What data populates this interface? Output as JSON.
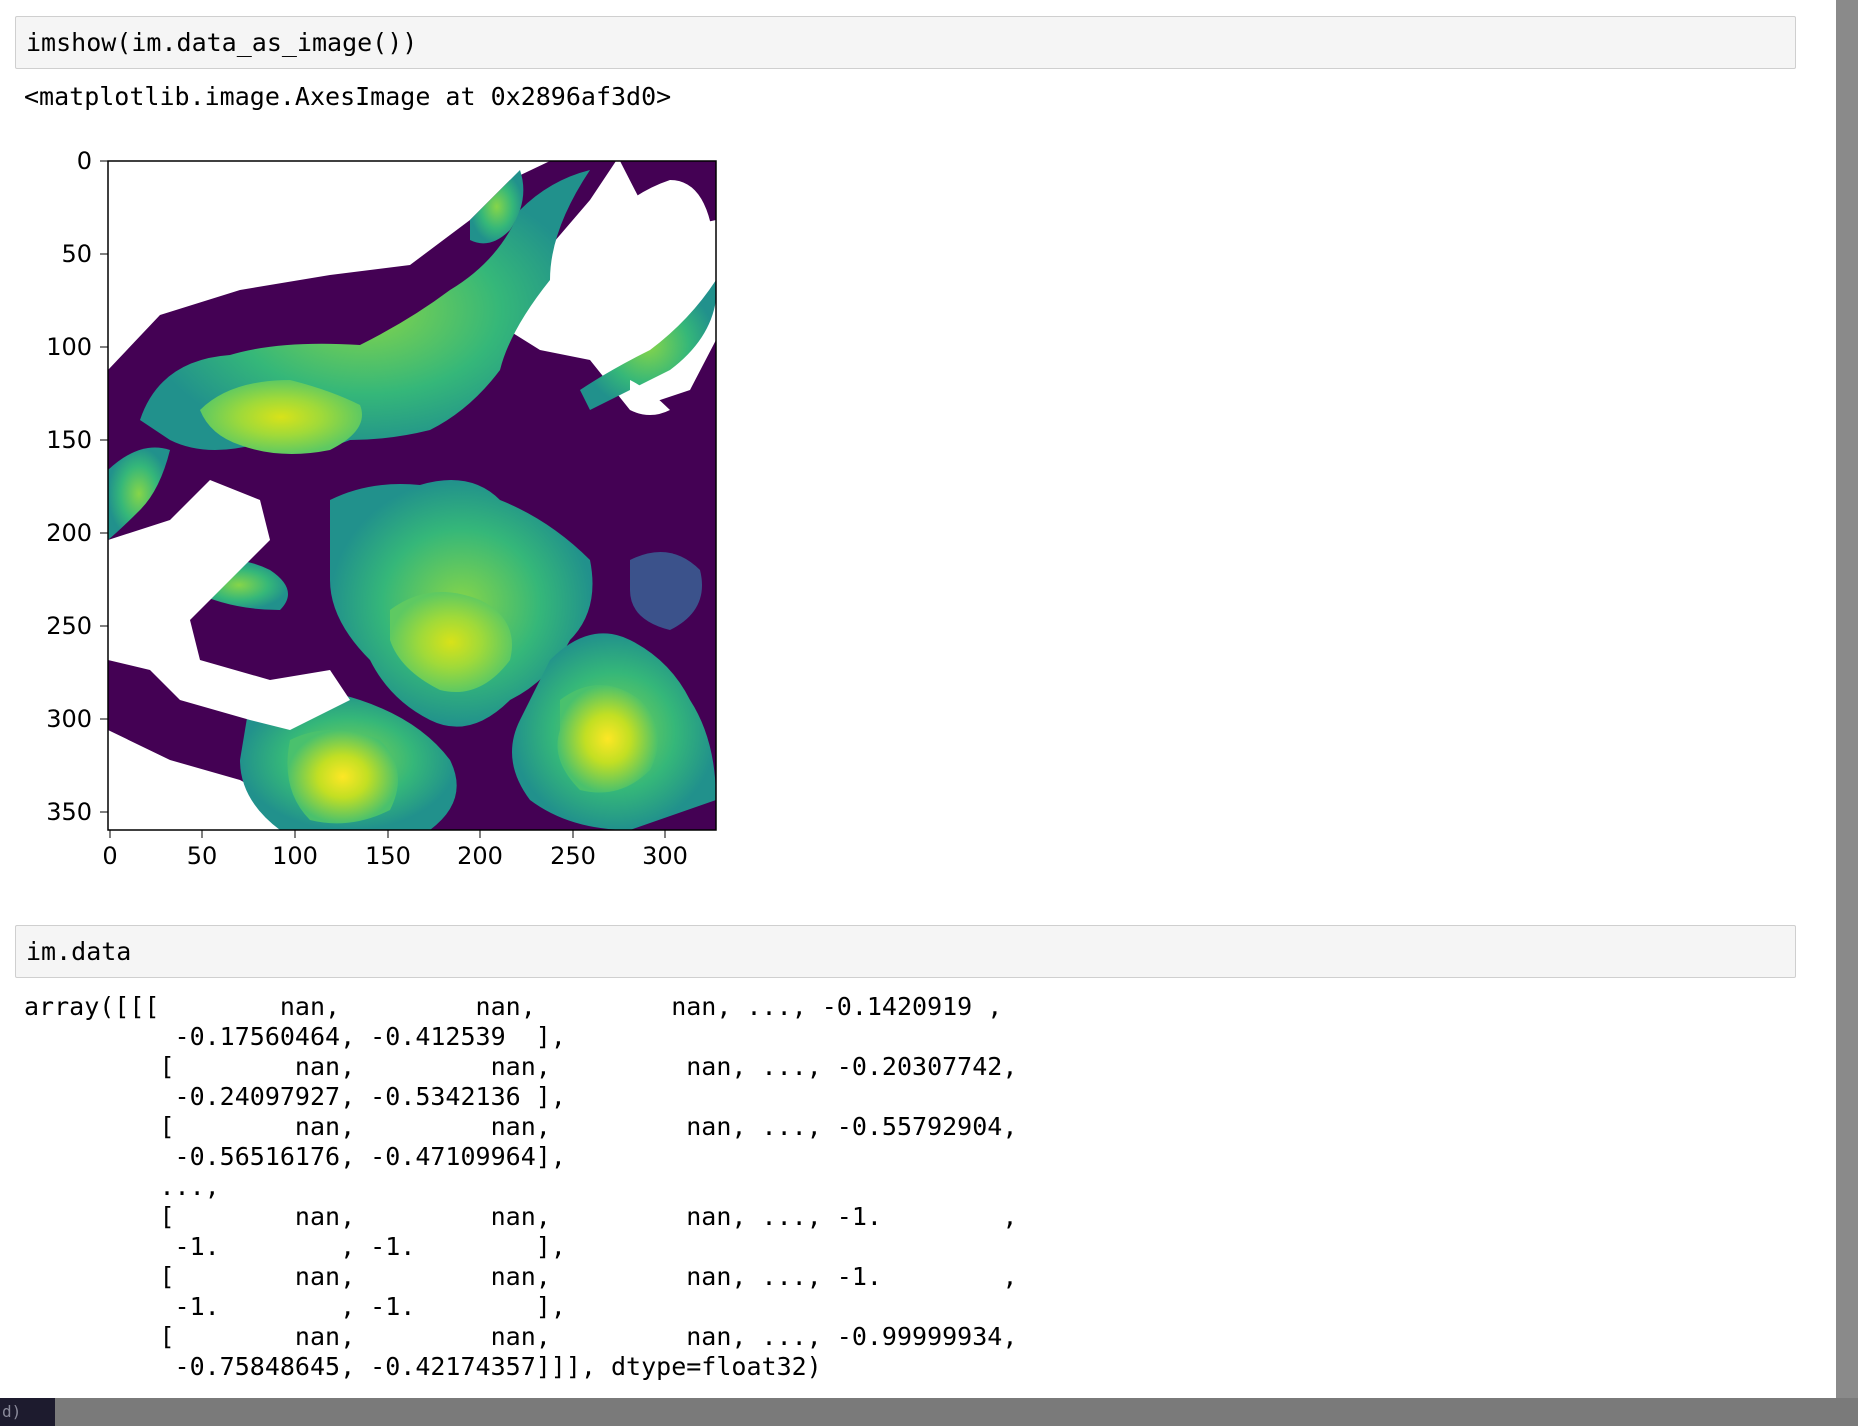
{
  "cells": [
    {
      "input": "imshow(im.data_as_image())",
      "output": "<matplotlib.image.AxesImage at 0x2896af3d0>"
    },
    {
      "input": "im.data",
      "output_lines": [
        "array([[[        nan,         nan,         nan, ..., -0.1420919 ,",
        "          -0.17560464, -0.412539  ],",
        "         [        nan,         nan,         nan, ..., -0.20307742,",
        "          -0.24097927, -0.5342136 ],",
        "         [        nan,         nan,         nan, ..., -0.55792904,",
        "          -0.56516176, -0.47109964],",
        "         ...,",
        "         [        nan,         nan,         nan, ..., -1.        ,",
        "          -1.        , -1.        ],",
        "         [        nan,         nan,         nan, ..., -1.        ,",
        "          -1.        , -1.        ],",
        "         [        nan,         nan,         nan, ..., -0.99999934,",
        "          -0.75848645, -0.42174357]]], dtype=float32)"
      ]
    }
  ],
  "chart_data": {
    "type": "heatmap",
    "colormap": "viridis",
    "x_ticks": [
      "0",
      "50",
      "100",
      "150",
      "200",
      "250",
      "300"
    ],
    "y_ticks": [
      "0",
      "50",
      "100",
      "150",
      "200",
      "250",
      "300",
      "350"
    ],
    "xlim": [
      0,
      327
    ],
    "ylim": [
      360,
      0
    ],
    "x_tick_values": [
      0,
      50,
      100,
      150,
      200,
      250,
      300
    ],
    "y_tick_values": [
      0,
      50,
      100,
      150,
      200,
      250,
      300,
      350
    ],
    "title": "",
    "xlabel": "",
    "ylabel": ""
  },
  "statusbar": {
    "tab_label": "d)"
  },
  "colors": {
    "cell_bg": "#f5f5f5",
    "cell_border": "#cfcfcf"
  }
}
